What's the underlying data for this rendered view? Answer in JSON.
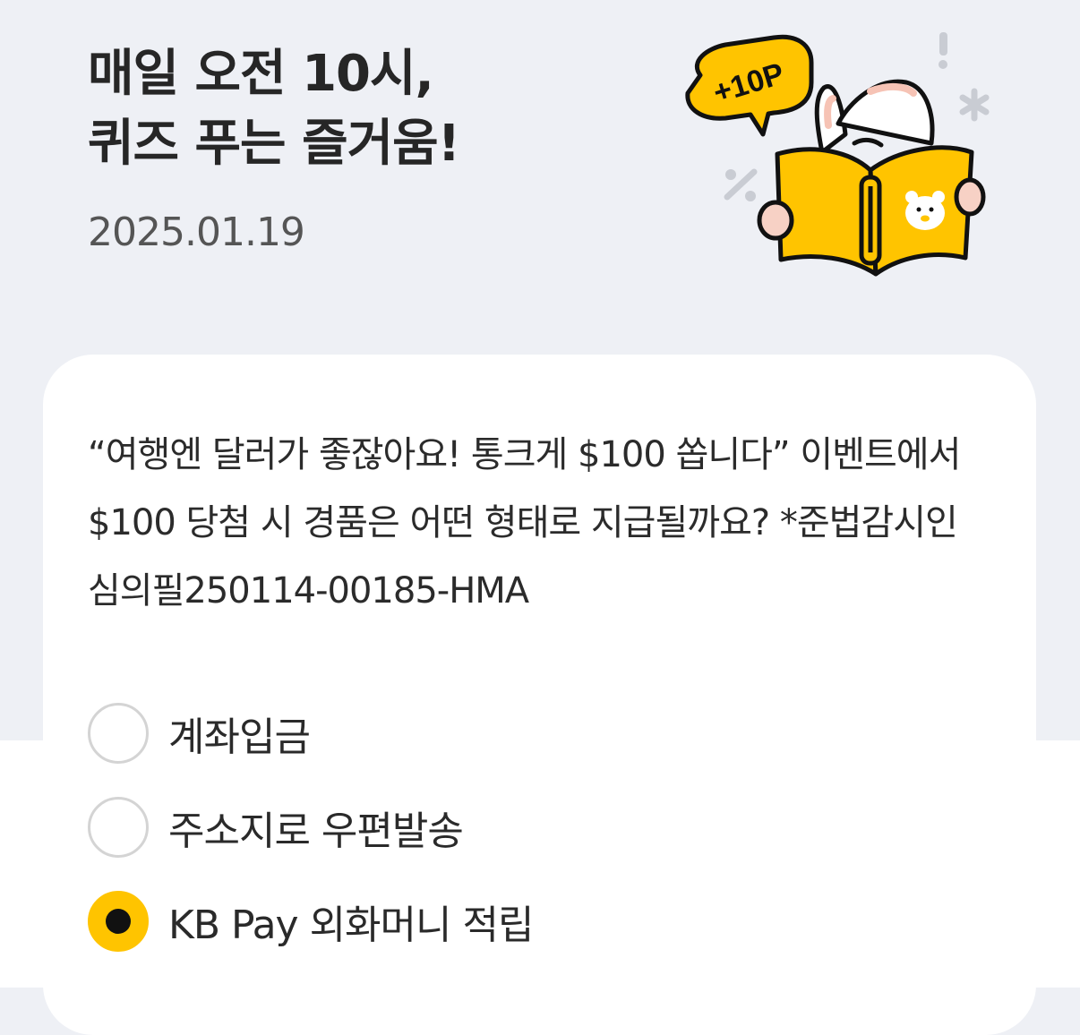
{
  "header": {
    "title_line1": "매일 오전 10시,",
    "title_line2": "퀴즈 푸는 즐거움!",
    "date": "2025.01.19"
  },
  "illustration": {
    "badge_text": "+10P",
    "icons": [
      "exclamation-icon",
      "asterisk-icon",
      "percent-icon",
      "bear-face-icon"
    ]
  },
  "quiz": {
    "question": "“여행엔 달러가 좋잖아요! 통크게 $100 쏩니다” 이벤트에서 $100 당첨 시 경품은 어떤 형태로 지급될까요? *준법감시인심의필250114-00185-HMA",
    "options": [
      {
        "label": "계좌입금",
        "selected": false
      },
      {
        "label": "주소지로 우편발송",
        "selected": false
      },
      {
        "label": "KB Pay 외화머니 적립",
        "selected": true
      }
    ]
  },
  "colors": {
    "background": "#eef0f5",
    "card": "#ffffff",
    "accent_yellow": "#ffc400",
    "radio_border": "#d4d4d4",
    "text_primary": "#262626",
    "text_secondary": "#555555"
  }
}
